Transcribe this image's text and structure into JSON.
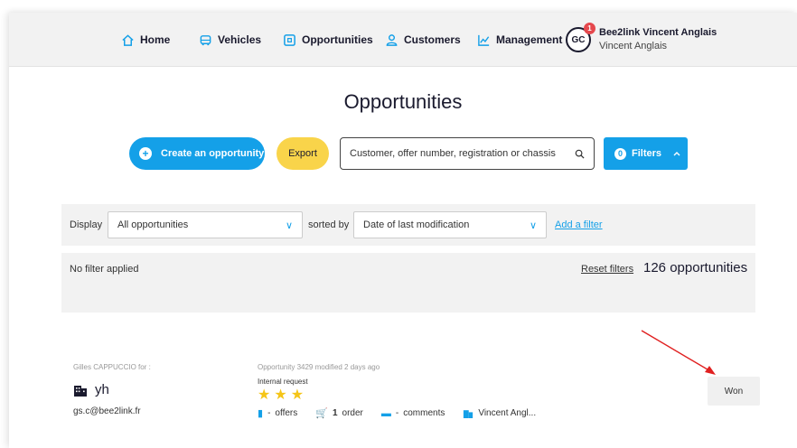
{
  "nav": {
    "home": "Home",
    "vehicles": "Vehicles",
    "opportunities": "Opportunities",
    "customers": "Customers",
    "management": "Management"
  },
  "user": {
    "initials": "GC",
    "notification_count": "1",
    "name": "Bee2link Vincent Anglais",
    "subname": "Vincent Anglais"
  },
  "page": {
    "title": "Opportunities"
  },
  "toolbar": {
    "create_label": "Create an opportunity",
    "export_label": "Export",
    "search_placeholder": "Customer, offer number, registration or chassis",
    "filters_count": "0",
    "filters_label": "Filters"
  },
  "filters": {
    "display_label": "Display",
    "display_value": "All opportunities",
    "sorted_by_label": "sorted by",
    "sort_value": "Date of last modification",
    "add_filter": "Add a filter"
  },
  "results": {
    "no_filter": "No filter applied",
    "reset": "Reset filters",
    "count": "126 opportunities"
  },
  "card": {
    "author": "Gilles CAPPUCCIO for :",
    "customer": "yh",
    "email": "gs.c@bee2link.fr",
    "opportunity_line": "Opportunity 3429 modified 2 days ago",
    "request_type": "Internal request",
    "rating": 3,
    "offers_count": "-",
    "offers_label": "offers",
    "orders_count": "1",
    "orders_label": "order",
    "comments_count": "-",
    "comments_label": "comments",
    "seller": "Vincent Angl...",
    "status": "Won"
  },
  "colors": {
    "accent": "#14a0e8",
    "export": "#f9d44a",
    "star": "#f5c518",
    "arrow": "#e02020"
  }
}
